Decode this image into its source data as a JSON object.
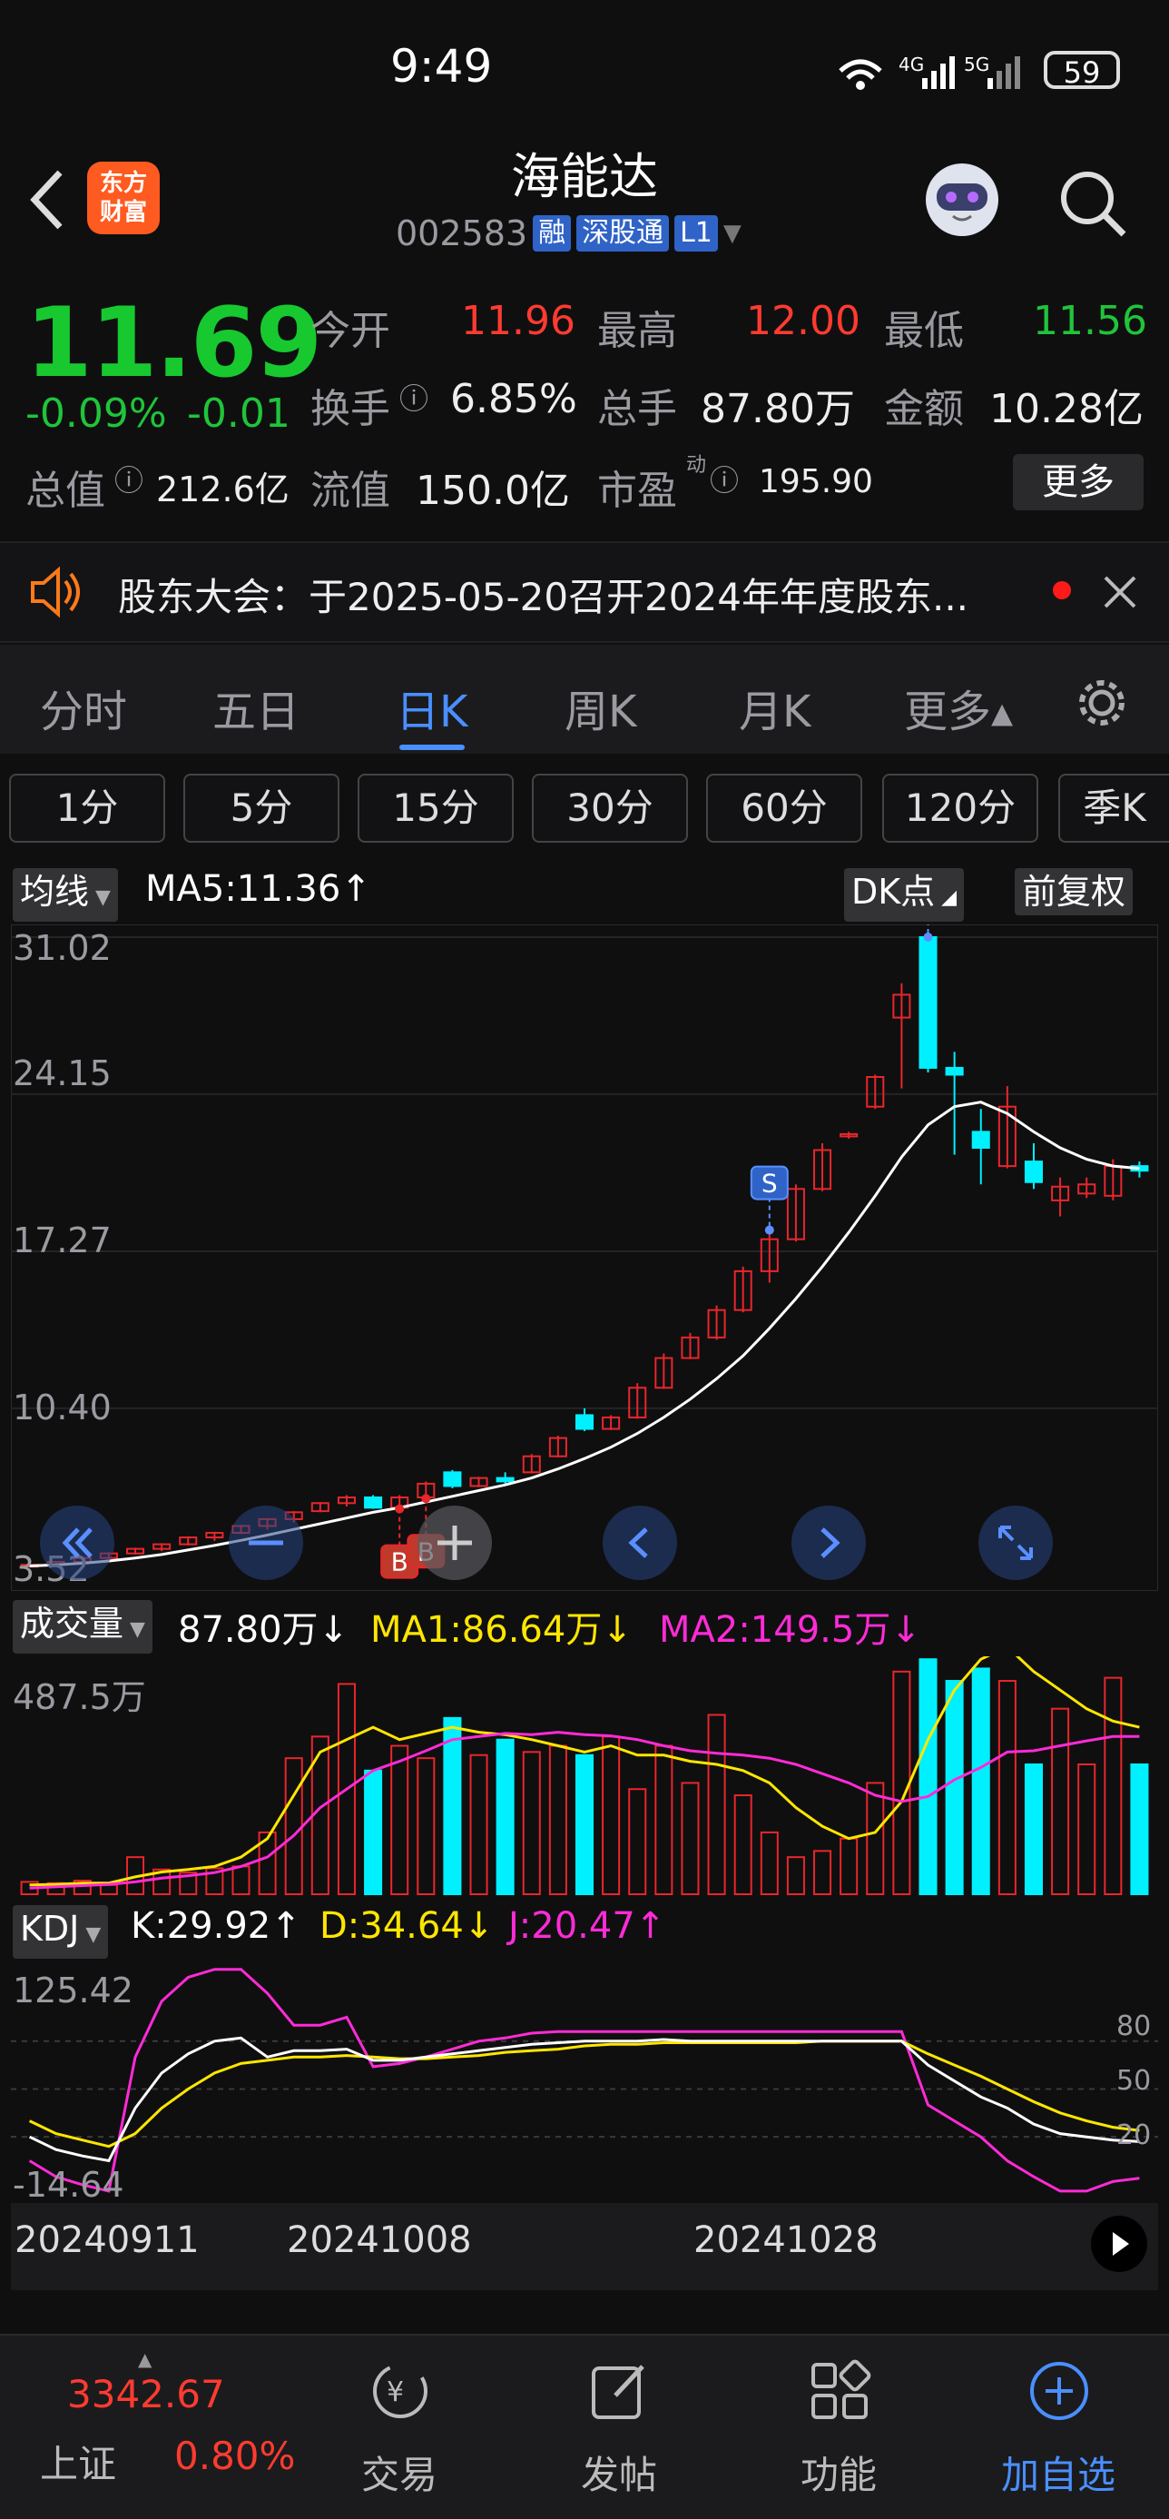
{
  "status_bar": {
    "time": "9:49",
    "network": "4G 5G",
    "battery": "59"
  },
  "header": {
    "stock_name": "海能达",
    "stock_code": "002583",
    "tags": [
      "融",
      "深股通",
      "L1"
    ],
    "logo_text": "东方财富"
  },
  "quote": {
    "price": "11.69",
    "change_pct": "-0.09%",
    "change": "-0.01",
    "open_label": "今开",
    "open": "11.96",
    "high_label": "最高",
    "high": "12.00",
    "low_label": "最低",
    "low": "11.56",
    "turnover_label": "换手",
    "turnover": "6.85%",
    "volume_label": "总手",
    "volume": "87.80万",
    "amount_label": "金额",
    "amount": "10.28亿",
    "mktcap_label": "总值",
    "mktcap": "212.6亿",
    "float_label": "流值",
    "float_cap": "150.0亿",
    "pe_label": "市盈",
    "pe_super": "动",
    "pe": "195.90",
    "more_label": "更多"
  },
  "notice": {
    "text": "股东大会：于2025-05-20召开2024年年度股东..."
  },
  "tabs": [
    "分时",
    "五日",
    "日K",
    "周K",
    "月K",
    "更多▴"
  ],
  "periods": [
    "1分",
    "5分",
    "15分",
    "30分",
    "60分",
    "120分",
    "季K"
  ],
  "kline": {
    "indicator_label": "均线",
    "ma_text": "MA5:11.36↑",
    "dk_label": "DK点",
    "adjust_label": "前复权",
    "y_ticks": [
      "31.02",
      "24.15",
      "17.27",
      "10.40",
      "3.52"
    ]
  },
  "volume_panel": {
    "label": "成交量",
    "value_text": "87.80万↓",
    "ma1_text": "MA1:86.64万↓",
    "ma2_text": "MA2:149.5万↓",
    "y_top": "487.5万"
  },
  "kdj_panel": {
    "label": "KDJ",
    "k_text": "K:29.92↑",
    "d_text": "D:34.64↓",
    "j_text": "J:20.47↑",
    "y_top": "125.42",
    "y_bottom": "-14.64",
    "levels": [
      "80",
      "50",
      "20"
    ]
  },
  "x_axis": [
    "20240911",
    "20241008",
    "20241028"
  ],
  "colors": {
    "up": "#e8262b",
    "down": "#00f0ff",
    "ma": "#ffffff",
    "ma1": "#ffe600",
    "ma2": "#ff2bd6",
    "accent": "#4a8fff"
  },
  "bottom_nav": {
    "index_value": "3342.67",
    "index_name": "上证",
    "index_change": "0.80%",
    "items": [
      "交易",
      "发帖",
      "功能",
      "加自选"
    ]
  },
  "chart_data": {
    "type": "candlestick",
    "ohlc": [
      [
        3.52,
        3.6,
        3.45,
        3.55
      ],
      [
        3.55,
        3.7,
        3.5,
        3.68
      ],
      [
        3.68,
        3.9,
        3.65,
        3.85
      ],
      [
        3.85,
        4.1,
        3.8,
        4.05
      ],
      [
        4.05,
        4.3,
        4.0,
        4.25
      ],
      [
        4.25,
        4.5,
        4.15,
        4.45
      ],
      [
        4.45,
        4.8,
        4.4,
        4.75
      ],
      [
        4.75,
        5.0,
        4.6,
        4.95
      ],
      [
        4.95,
        5.3,
        4.9,
        5.25
      ],
      [
        5.25,
        5.6,
        5.1,
        5.55
      ],
      [
        5.55,
        5.9,
        5.4,
        5.85
      ],
      [
        5.9,
        6.3,
        5.85,
        6.25
      ],
      [
        6.25,
        6.6,
        6.1,
        6.5
      ],
      [
        6.5,
        6.6,
        6.0,
        6.05
      ],
      [
        6.05,
        6.6,
        6.0,
        6.5
      ],
      [
        6.5,
        7.2,
        6.45,
        7.1
      ],
      [
        7.6,
        7.7,
        6.9,
        7.0
      ],
      [
        7.0,
        7.4,
        6.95,
        7.35
      ],
      [
        7.35,
        7.6,
        7.0,
        7.2
      ],
      [
        7.6,
        8.4,
        7.55,
        8.3
      ],
      [
        8.3,
        9.2,
        8.25,
        9.1
      ],
      [
        10.1,
        10.4,
        9.4,
        9.5
      ],
      [
        9.5,
        10.1,
        9.45,
        10.0
      ],
      [
        10.0,
        11.5,
        9.95,
        11.3
      ],
      [
        11.3,
        12.8,
        11.25,
        12.6
      ],
      [
        12.6,
        13.7,
        12.55,
        13.5
      ],
      [
        13.5,
        14.9,
        13.4,
        14.7
      ],
      [
        14.7,
        16.6,
        14.6,
        16.4
      ],
      [
        16.4,
        18.2,
        15.9,
        17.8
      ],
      [
        17.8,
        20.2,
        17.7,
        20.0
      ],
      [
        20.0,
        22.0,
        19.9,
        21.7
      ],
      [
        22.3,
        22.5,
        22.2,
        22.4
      ],
      [
        23.6,
        25.0,
        23.5,
        24.9
      ],
      [
        27.5,
        29.0,
        24.4,
        28.5
      ],
      [
        31.02,
        31.02,
        25.1,
        25.3
      ],
      [
        25.3,
        26.0,
        21.5,
        25.0
      ],
      [
        22.5,
        23.5,
        20.2,
        21.8
      ],
      [
        21.0,
        24.5,
        20.9,
        23.6
      ],
      [
        21.2,
        22.0,
        20.0,
        20.3
      ],
      [
        19.5,
        20.5,
        18.8,
        20.1
      ],
      [
        19.8,
        20.5,
        19.6,
        20.2
      ],
      [
        19.7,
        21.3,
        19.5,
        21.0
      ],
      [
        21.0,
        21.2,
        20.5,
        20.8
      ]
    ],
    "ma5": [
      3.5,
      3.55,
      3.62,
      3.72,
      3.85,
      4.0,
      4.2,
      4.4,
      4.62,
      4.85,
      5.1,
      5.35,
      5.6,
      5.85,
      6.05,
      6.3,
      6.55,
      6.8,
      7.05,
      7.35,
      7.75,
      8.2,
      8.7,
      9.3,
      10.0,
      10.8,
      11.7,
      12.7,
      13.9,
      15.2,
      16.6,
      18.1,
      19.7,
      21.4,
      22.8,
      23.6,
      23.8,
      23.3,
      22.5,
      21.8,
      21.3,
      21.0,
      20.9
    ],
    "volume": [
      20,
      18,
      22,
      15,
      60,
      40,
      35,
      42,
      45,
      100,
      220,
      255,
      340,
      200,
      240,
      220,
      285,
      225,
      250,
      230,
      240,
      225,
      255,
      170,
      240,
      180,
      290,
      160,
      100,
      60,
      70,
      90,
      180,
      360,
      380,
      345,
      365,
      345,
      210,
      300,
      210,
      350,
      210
    ],
    "vol_ma1": [
      15,
      16,
      18,
      18,
      28,
      36,
      40,
      45,
      60,
      90,
      160,
      230,
      250,
      270,
      250,
      260,
      270,
      262,
      258,
      250,
      240,
      230,
      240,
      225,
      225,
      215,
      210,
      200,
      180,
      140,
      110,
      90,
      100,
      150,
      250,
      330,
      380,
      400,
      360,
      330,
      300,
      280,
      270
    ],
    "vol_ma2": [
      10,
      12,
      14,
      16,
      20,
      26,
      30,
      35,
      45,
      60,
      95,
      140,
      170,
      200,
      215,
      232,
      250,
      255,
      260,
      258,
      262,
      258,
      256,
      250,
      240,
      232,
      228,
      225,
      220,
      210,
      195,
      180,
      160,
      150,
      158,
      185,
      205,
      230,
      232,
      240,
      248,
      255,
      255
    ],
    "k": [
      20,
      12,
      8,
      5,
      38,
      60,
      72,
      80,
      82,
      70,
      74,
      74,
      75,
      68,
      68,
      70,
      72,
      74,
      76,
      78,
      79,
      80,
      80,
      80,
      81,
      80,
      80,
      80,
      80,
      80,
      80,
      80,
      80,
      80,
      65,
      55,
      45,
      38,
      28,
      22,
      20,
      18,
      17
    ],
    "d": [
      30,
      22,
      18,
      14,
      22,
      38,
      50,
      60,
      66,
      68,
      70,
      70,
      71,
      70,
      69,
      69,
      70,
      71,
      73,
      74,
      75,
      77,
      78,
      78,
      79,
      79,
      79,
      79,
      79,
      79,
      80,
      80,
      80,
      80,
      72,
      65,
      58,
      50,
      42,
      35,
      30,
      26,
      24
    ],
    "j": [
      5,
      -5,
      -10,
      -14,
      70,
      105,
      120,
      125,
      125,
      110,
      90,
      90,
      95,
      64,
      66,
      70,
      75,
      80,
      82,
      85,
      86,
      86,
      86,
      86,
      86,
      86,
      86,
      86,
      86,
      86,
      86,
      86,
      86,
      86,
      40,
      30,
      20,
      5,
      -5,
      -14,
      -14,
      -8,
      -6
    ]
  }
}
